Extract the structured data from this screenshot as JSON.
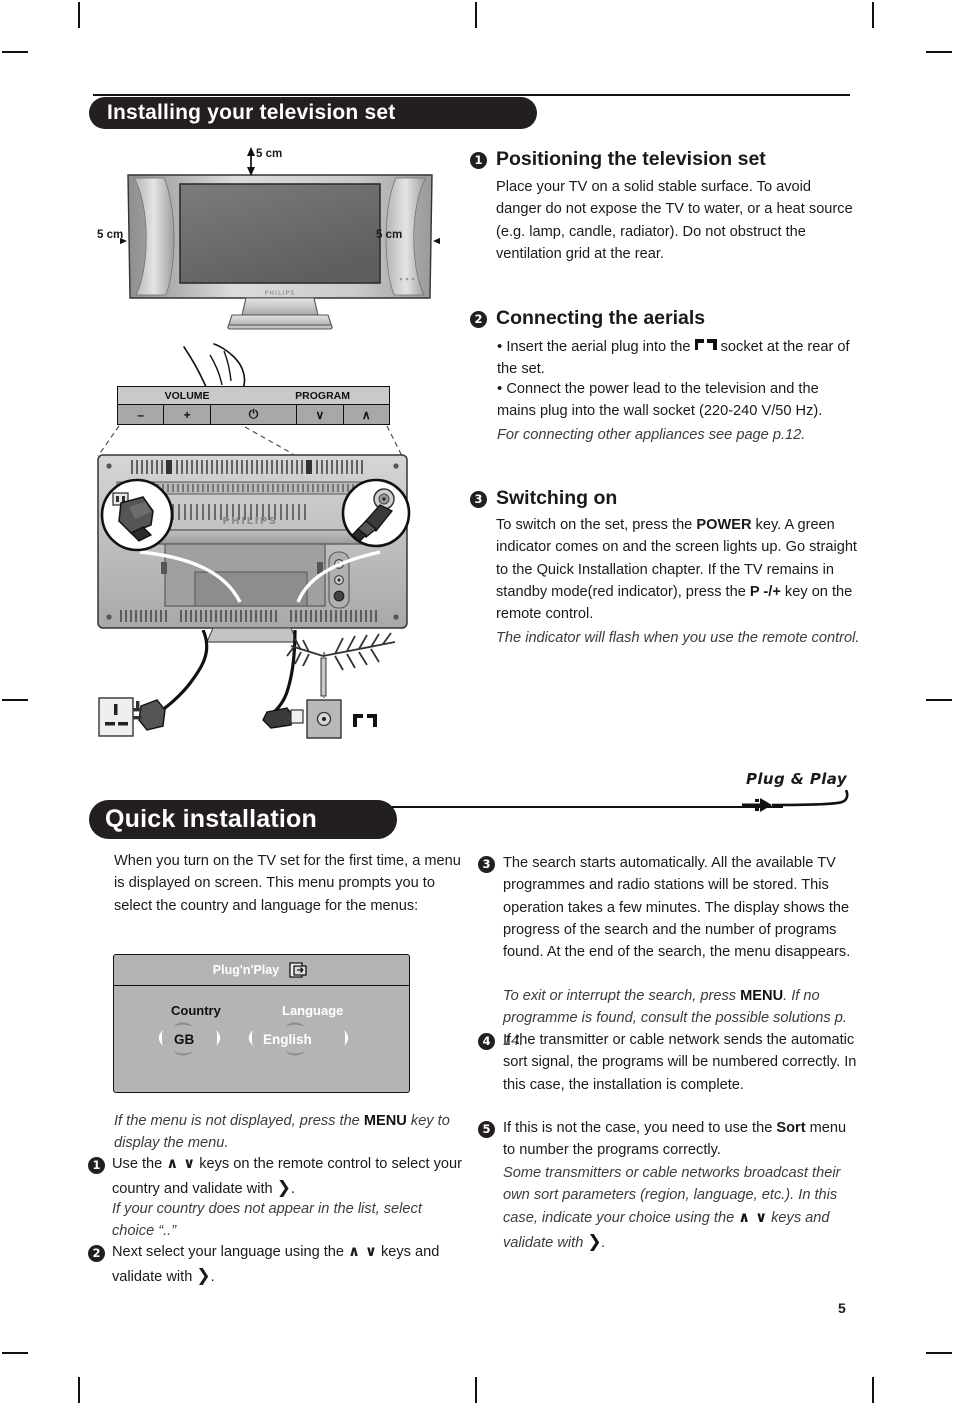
{
  "document": {
    "page_number": "5"
  },
  "section1": {
    "banner_title": "Installing your television set",
    "diagram": {
      "dim_top": "5 cm",
      "dim_left": "5 cm",
      "dim_right": "5 cm",
      "brand": "PHILIPS",
      "control_panel": {
        "volume_label": "VOLUME",
        "program_label": "PROGRAM",
        "minus": "–",
        "plus": "+",
        "power": "⏻",
        "down": "∨",
        "up": "∧"
      }
    },
    "items": [
      {
        "number": "1",
        "heading": "Positioning the television set",
        "body": "Place your TV on a solid stable surface.  To avoid danger do not expose the TV to water, or a heat source (e.g. lamp, candle, radiator).  Do not obstruct the ventilation grid at the rear."
      },
      {
        "number": "2",
        "heading": "Connecting the aerials",
        "bullet1_a": "Insert the aerial plug into the",
        "bullet1_b": "socket at the rear of the set.",
        "bullet2": "Connect the power lead to the television and the mains plug into the wall socket (220-240 V/50 Hz).",
        "note": "For connecting other appliances see page p.12."
      },
      {
        "number": "3",
        "heading": "Switching on",
        "body_1": "To switch on the set, press the ",
        "body_key1": "POWER",
        "body_2": " key.  A green indicator comes on and the screen lights up.  Go straight to the Quick Installation chapter. If the TV remains in standby mode(red indicator), press the ",
        "body_key2": "P -/+",
        "body_3": " key on the remote control.",
        "note": "The indicator will flash when you use the remote control."
      }
    ]
  },
  "section2": {
    "banner_title": "Quick installation",
    "logo": "Plug & Play",
    "intro": "When you turn on the TV set for the first time, a menu is displayed on screen. This menu prompts you to select the country and language for the menus:",
    "menu": {
      "title": "Plug'n'Play",
      "country_label": "Country",
      "language_label": "Language",
      "country_value": "GB",
      "language_value": "English"
    },
    "note_menu_1": "If the menu is not displayed, press the ",
    "note_menu_key": "MENU",
    "note_menu_2": " key to display the menu.",
    "left_items": [
      {
        "number": "1",
        "body_1": "Use the ",
        "keys": "∧ ∨",
        "body_2": " keys on the remote control to select your country and validate with ",
        "validate": "❯",
        "body_3": ".",
        "note": "If your country does not appear in the list, select choice “..”"
      },
      {
        "number": "2",
        "body_1": "Next select your language using the ",
        "keys": "∧ ∨",
        "body_2": " keys and validate with ",
        "validate": "❯",
        "body_3": "."
      }
    ],
    "right_items": [
      {
        "number": "3",
        "body": "The search starts automatically. All the available TV programmes and radio stations will be stored. This operation takes a few minutes. The display shows the progress of the search and the number of programs found.  At the end of the search, the menu disappears.",
        "note_1": "To exit or interrupt the search, press ",
        "note_key": "MENU",
        "note_2": ". If no programme is found, consult the possible solutions p. 14."
      },
      {
        "number": "4",
        "body": "If the transmitter or cable network sends the automatic sort signal, the programs will be numbered correctly. In this case, the installation is complete."
      },
      {
        "number": "5",
        "body_1": "If this is not the case, you need to use the ",
        "body_key": "Sort",
        "body_2": " menu to number the programs correctly.",
        "note_1": "Some transmitters or cable networks broadcast their own sort parameters (region, language, etc.). In this case, indicate your choice using the ",
        "note_keys": "∧ ∨",
        "note_2": " keys and validate with ",
        "note_validate": "❯",
        "note_3": "."
      }
    ]
  }
}
